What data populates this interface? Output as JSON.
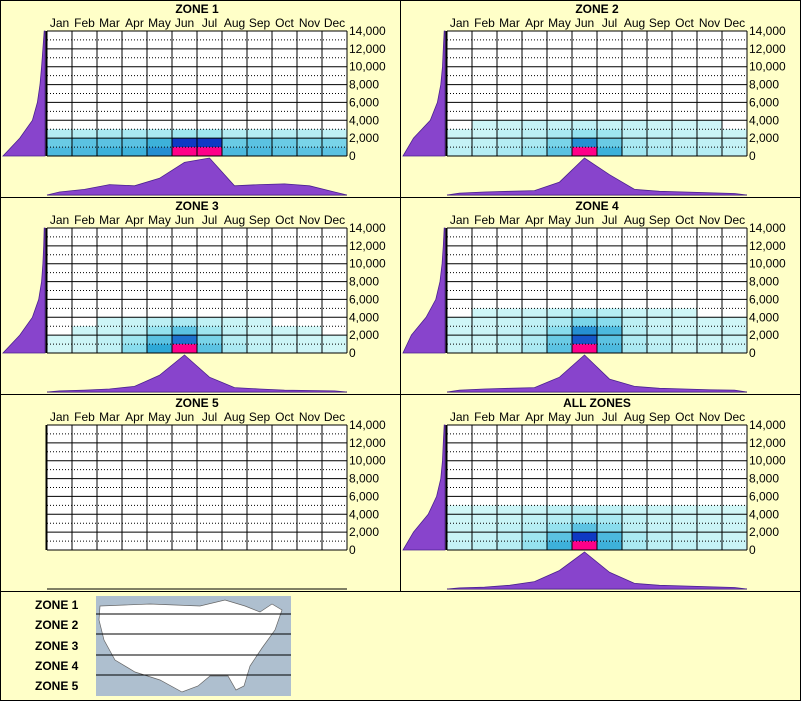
{
  "months": [
    "Jan",
    "Feb",
    "Mar",
    "Apr",
    "May",
    "Jun",
    "Jul",
    "Aug",
    "Sep",
    "Oct",
    "Nov",
    "Dec"
  ],
  "y_ticks": [
    "14,000",
    "12,000",
    "10,000",
    "8,000",
    "6,000",
    "4,000",
    "2,000",
    "0"
  ],
  "colors": {
    "background": "#ffffc8",
    "plot": "#ffffff",
    "profile": "#8844cc",
    "profile_line": "#4b2190",
    "heat_low": "#d6f8f8",
    "heat_mid": "#2ba6d6",
    "heat_high": "#0000bb",
    "heat_peak": "#ff0088",
    "map_water": "#aebfcf",
    "map_land": "#ffffff"
  },
  "chart_data": [
    {
      "type": "heatmap",
      "title": "ZONE 1",
      "x_categories": [
        "Jan",
        "Feb",
        "Mar",
        "Apr",
        "May",
        "Jun",
        "Jul",
        "Aug",
        "Sep",
        "Oct",
        "Nov",
        "Dec"
      ],
      "ylim": [
        0,
        14000
      ],
      "grid": true,
      "density_rows": [
        [
          0.55,
          0.55,
          0.6,
          0.6,
          0.7,
          1.0,
          1.0,
          0.55,
          0.55,
          0.5,
          0.5,
          0.5
        ],
        [
          0.45,
          0.5,
          0.5,
          0.5,
          0.6,
          0.85,
          0.85,
          0.45,
          0.5,
          0.45,
          0.4,
          0.4
        ],
        [
          0.15,
          0.15,
          0.2,
          0.2,
          0.2,
          0.25,
          0.25,
          0.15,
          0.15,
          0.15,
          0.15,
          0.1
        ]
      ],
      "month_profile": [
        0.08,
        0.15,
        0.28,
        0.25,
        0.45,
        0.88,
        1.0,
        0.25,
        0.28,
        0.3,
        0.25,
        0.08
      ],
      "elevation_profile": [
        0.02,
        0.05,
        0.08,
        0.12,
        0.18,
        0.3,
        0.6,
        1.0
      ]
    },
    {
      "type": "heatmap",
      "title": "ZONE 2",
      "x_categories": [
        "Jan",
        "Feb",
        "Mar",
        "Apr",
        "May",
        "Jun",
        "Jul",
        "Aug",
        "Sep",
        "Oct",
        "Nov",
        "Dec"
      ],
      "ylim": [
        0,
        14000
      ],
      "grid": true,
      "density_rows": [
        [
          0.12,
          0.15,
          0.2,
          0.3,
          0.5,
          1.0,
          0.6,
          0.25,
          0.2,
          0.15,
          0.15,
          0.1
        ],
        [
          0.08,
          0.1,
          0.15,
          0.2,
          0.4,
          0.7,
          0.45,
          0.2,
          0.15,
          0.1,
          0.1,
          0.08
        ],
        [
          0.05,
          0.05,
          0.1,
          0.12,
          0.2,
          0.3,
          0.25,
          0.12,
          0.1,
          0.08,
          0.05,
          0.05
        ],
        [
          0,
          0.04,
          0.05,
          0.08,
          0.08,
          0.1,
          0.08,
          0.08,
          0.05,
          0.04,
          0.04,
          0
        ]
      ],
      "month_profile": [
        0.05,
        0.08,
        0.1,
        0.12,
        0.35,
        1.0,
        0.55,
        0.15,
        0.1,
        0.08,
        0.06,
        0.04
      ],
      "elevation_profile": [
        0.02,
        0.04,
        0.06,
        0.1,
        0.18,
        0.35,
        0.75,
        1.0
      ]
    },
    {
      "type": "heatmap",
      "title": "ZONE 3",
      "x_categories": [
        "Jan",
        "Feb",
        "Mar",
        "Apr",
        "May",
        "Jun",
        "Jul",
        "Aug",
        "Sep",
        "Oct",
        "Nov",
        "Dec"
      ],
      "ylim": [
        0,
        14000
      ],
      "grid": true,
      "density_rows": [
        [
          0.02,
          0.05,
          0.1,
          0.35,
          0.65,
          1.0,
          0.5,
          0.2,
          0.1,
          0.05,
          0.04,
          0.02
        ],
        [
          0.02,
          0.05,
          0.1,
          0.25,
          0.5,
          0.75,
          0.4,
          0.15,
          0.08,
          0.05,
          0.03,
          0.02
        ],
        [
          0,
          0.04,
          0.06,
          0.12,
          0.3,
          0.5,
          0.25,
          0.1,
          0.05,
          0.04,
          0.02,
          0
        ],
        [
          0,
          0,
          0.04,
          0.06,
          0.12,
          0.2,
          0.1,
          0.06,
          0.04,
          0,
          0,
          0
        ]
      ],
      "month_profile": [
        0.03,
        0.05,
        0.08,
        0.15,
        0.45,
        1.0,
        0.4,
        0.12,
        0.08,
        0.05,
        0.04,
        0.03
      ],
      "elevation_profile": [
        0.02,
        0.03,
        0.05,
        0.08,
        0.15,
        0.3,
        0.6,
        1.0
      ]
    },
    {
      "type": "heatmap",
      "title": "ZONE 4",
      "x_categories": [
        "Jan",
        "Feb",
        "Mar",
        "Apr",
        "May",
        "Jun",
        "Jul",
        "Aug",
        "Sep",
        "Oct",
        "Nov",
        "Dec"
      ],
      "ylim": [
        0,
        14000
      ],
      "grid": true,
      "density_rows": [
        [
          0.05,
          0.06,
          0.1,
          0.2,
          0.5,
          1.0,
          0.55,
          0.2,
          0.12,
          0.06,
          0.05,
          0.05
        ],
        [
          0.05,
          0.06,
          0.1,
          0.18,
          0.45,
          0.8,
          0.5,
          0.18,
          0.1,
          0.06,
          0.05,
          0.05
        ],
        [
          0.04,
          0.05,
          0.08,
          0.15,
          0.35,
          0.7,
          0.55,
          0.15,
          0.08,
          0.05,
          0.04,
          0.04
        ],
        [
          0.03,
          0.04,
          0.06,
          0.1,
          0.2,
          0.4,
          0.35,
          0.12,
          0.06,
          0.04,
          0.03,
          0.03
        ],
        [
          0,
          0.03,
          0.05,
          0.06,
          0.1,
          0.18,
          0.15,
          0.06,
          0.05,
          0.03,
          0,
          0
        ]
      ],
      "month_profile": [
        0.05,
        0.08,
        0.1,
        0.12,
        0.4,
        1.0,
        0.35,
        0.15,
        0.1,
        0.08,
        0.06,
        0.05
      ],
      "elevation_profile": [
        0.02,
        0.04,
        0.07,
        0.12,
        0.22,
        0.45,
        0.8,
        1.0
      ]
    },
    {
      "type": "heatmap",
      "title": "ZONE 5",
      "x_categories": [
        "Jan",
        "Feb",
        "Mar",
        "Apr",
        "May",
        "Jun",
        "Jul",
        "Aug",
        "Sep",
        "Oct",
        "Nov",
        "Dec"
      ],
      "ylim": [
        0,
        14000
      ],
      "grid": true,
      "density_rows": [],
      "month_profile": [],
      "elevation_profile": []
    },
    {
      "type": "heatmap",
      "title": "ALL ZONES",
      "x_categories": [
        "Jan",
        "Feb",
        "Mar",
        "Apr",
        "May",
        "Jun",
        "Jul",
        "Aug",
        "Sep",
        "Oct",
        "Nov",
        "Dec"
      ],
      "ylim": [
        0,
        14000
      ],
      "grid": true,
      "density_rows": [
        [
          0.08,
          0.1,
          0.15,
          0.3,
          0.6,
          1.0,
          0.6,
          0.2,
          0.12,
          0.1,
          0.08,
          0.06
        ],
        [
          0.06,
          0.08,
          0.12,
          0.25,
          0.5,
          0.85,
          0.55,
          0.2,
          0.12,
          0.08,
          0.06,
          0.05
        ],
        [
          0.05,
          0.06,
          0.1,
          0.15,
          0.3,
          0.5,
          0.35,
          0.12,
          0.08,
          0.06,
          0.05,
          0.04
        ],
        [
          0.03,
          0.04,
          0.06,
          0.1,
          0.15,
          0.25,
          0.2,
          0.1,
          0.06,
          0.04,
          0.03,
          0.03
        ],
        [
          0.02,
          0.03,
          0.05,
          0.06,
          0.1,
          0.12,
          0.1,
          0.06,
          0.05,
          0.03,
          0.02,
          0.02
        ]
      ],
      "month_profile": [
        0.03,
        0.05,
        0.1,
        0.2,
        0.5,
        1.0,
        0.45,
        0.15,
        0.1,
        0.08,
        0.06,
        0.04
      ],
      "elevation_profile": [
        0.02,
        0.04,
        0.06,
        0.1,
        0.2,
        0.4,
        0.75,
        1.0
      ]
    }
  ],
  "legend": {
    "zones": [
      "ZONE 1",
      "ZONE 2",
      "ZONE 3",
      "ZONE 4",
      "ZONE 5"
    ]
  }
}
